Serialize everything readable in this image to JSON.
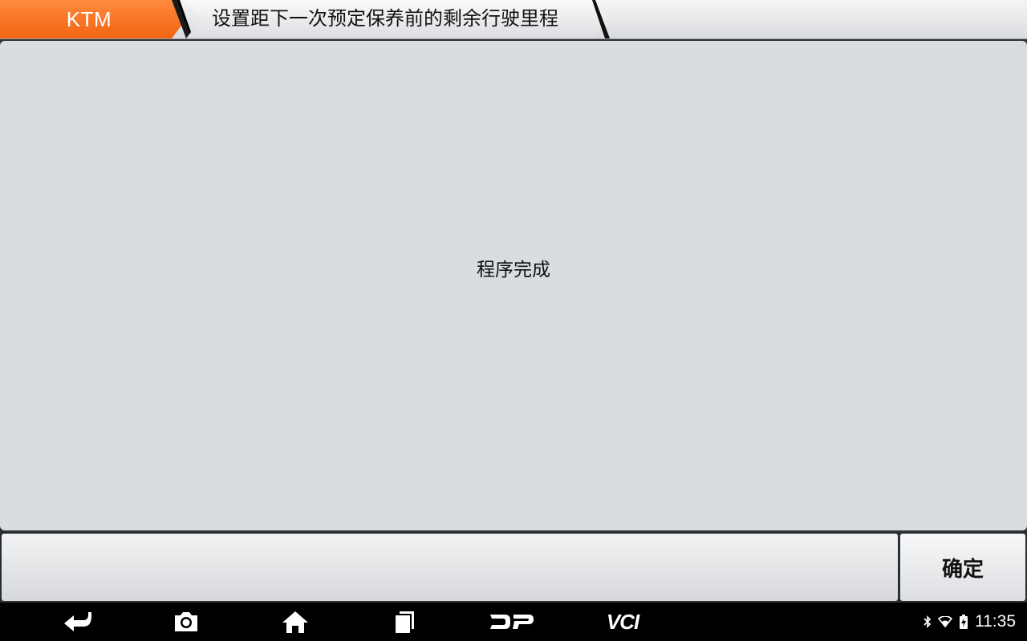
{
  "header": {
    "brand": "KTM",
    "title": "设置距下一次预定保养前的剩余行驶里程"
  },
  "main": {
    "message": "程序完成"
  },
  "actions": {
    "confirm_label": "确定"
  },
  "system_nav": {
    "items": [
      {
        "name": "back",
        "icon": "back-arrow-icon"
      },
      {
        "name": "screenshot",
        "icon": "camera-icon"
      },
      {
        "name": "home",
        "icon": "home-icon"
      },
      {
        "name": "recents",
        "icon": "recents-icon"
      },
      {
        "name": "dp",
        "icon": "dp-logo-icon"
      },
      {
        "name": "vci",
        "label": "VCI"
      }
    ],
    "status": {
      "bluetooth": true,
      "wifi": true,
      "battery": "charging",
      "time": "11:35"
    }
  },
  "colors": {
    "brand_orange": "#f26412",
    "panel_bg": "#d9dde0",
    "bar_bg": "#000000"
  }
}
